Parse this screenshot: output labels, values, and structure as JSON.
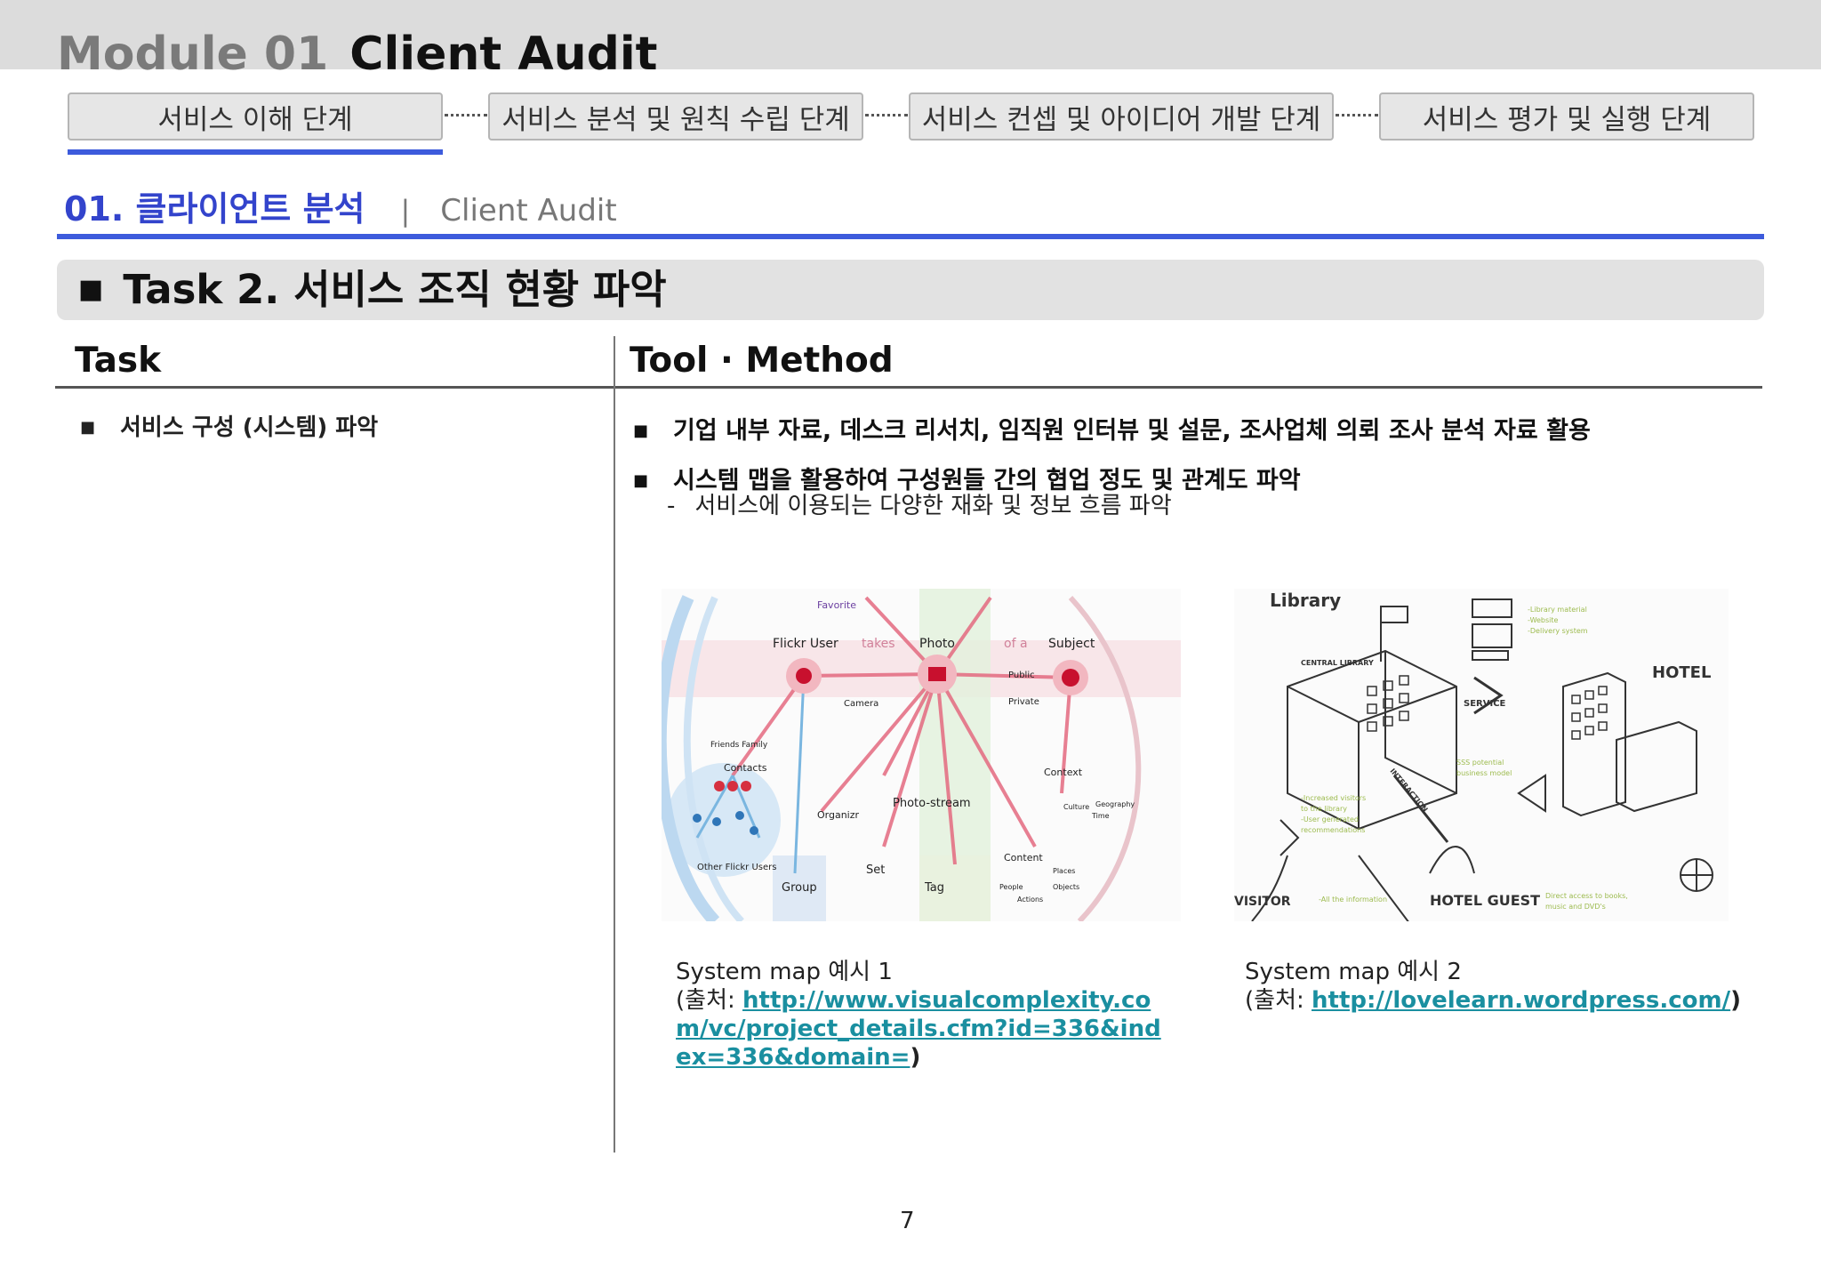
{
  "header": {
    "module_number": "Module 01",
    "module_title": "Client Audit"
  },
  "steps": [
    {
      "label": "서비스 이해 단계"
    },
    {
      "label": "서비스 분석 및 원칙 수립 단계"
    },
    {
      "label": "서비스 컨셉 및 아이디어 개발 단계"
    },
    {
      "label": "서비스 평가 및 실행 단계"
    }
  ],
  "section": {
    "title_kr": "01. 클라이언트 분석",
    "separator": "|",
    "title_en": "Client Audit"
  },
  "task_banner": {
    "title": "Task 2. 서비스 조직 현황 파악"
  },
  "table": {
    "col_task": "Task",
    "col_method": "Tool · Method",
    "task_items": [
      "서비스 구성 (시스템) 파악"
    ],
    "method_items": [
      "기업 내부 자료, 데스크 리서치, 임직원 인터뷰 및 설문, 조사업체 의뢰 조사 분석 자료 활용",
      "시스템 맵을 활용하여 구성원들 간의 협업 정도 및 관계도 파악"
    ],
    "method_sub": "서비스에 이용되는 다양한 재화 및 정보 흐름 파악"
  },
  "figure1": {
    "caption": "System map 예시 1",
    "source_prefix": "(출처: ",
    "link": "http://www.visualcomplexity.com/vc/project_details.cfm?id=336&index=336&domain=",
    "source_suffix": ")",
    "labels": {
      "flickr_user": "Flickr User",
      "takes": "takes",
      "photo": "Photo",
      "of_a": "of a",
      "subject": "Subject",
      "favorite": "Favorite",
      "public": "Public",
      "private": "Private",
      "camera": "Camera",
      "contacts": "Contacts",
      "friends_family": "Friends  Family",
      "organizr": "Organizr",
      "photostream": "Photo-stream",
      "context": "Context",
      "content": "Content",
      "set": "Set",
      "tag": "Tag",
      "group": "Group",
      "other_users": "Other Flickr Users",
      "places": "Places",
      "objects": "Objects",
      "people": "People",
      "actions": "Actions",
      "geography": "Geography",
      "culture": "Culture",
      "time": "Time"
    }
  },
  "figure2": {
    "caption": "System map 예시 2",
    "source_prefix": "(출처: ",
    "link": "http://lovelearn.wordpress.com/",
    "source_suffix": ")",
    "labels": {
      "library": "Library",
      "hotel": "HOTEL",
      "service": "SERVICE",
      "visitor": "VISITOR",
      "hotel_guest": "HOTEL GUEST",
      "central_library": "CENTRAL LIBRARY",
      "interaction": "INTERACTION"
    }
  },
  "page_number": "7",
  "colors": {
    "accent": "#3d5bdc",
    "link": "#1a8fa0"
  }
}
